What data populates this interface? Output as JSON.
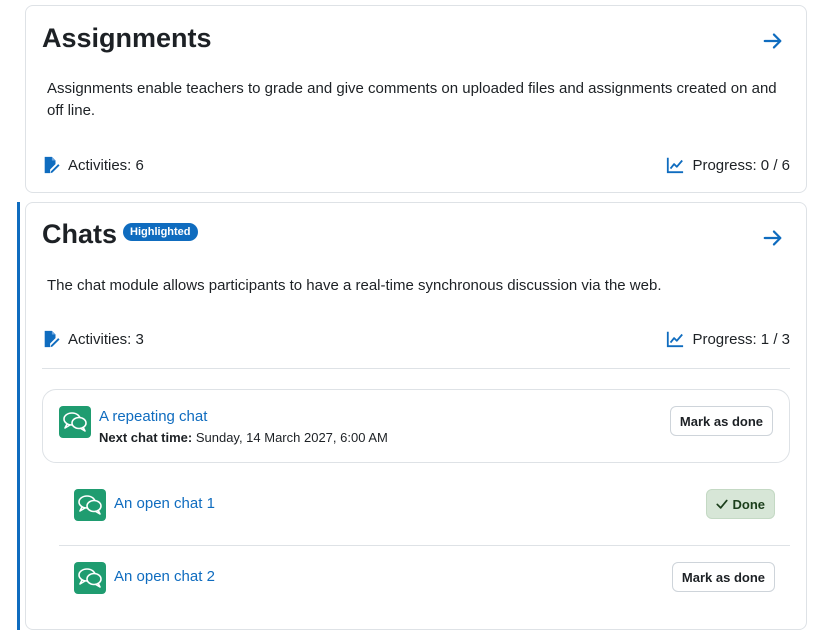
{
  "sections": [
    {
      "title": "Assignments",
      "description": "Assignments enable teachers to grade and give comments on uploaded files and assignments created on and off line.",
      "activities_label": "Activities: 6",
      "progress_label": "Progress: 0 / 6"
    },
    {
      "title": "Chats",
      "badge": "Highlighted",
      "description": "The chat module allows participants to have a real-time synchronous discussion via the web.",
      "activities_label": "Activities: 3",
      "progress_label": "Progress: 1 / 3",
      "activities": [
        {
          "name": "A repeating chat",
          "meta_label": "Next chat time:",
          "meta_value": "Sunday, 14 March 2027, 6:00 AM",
          "button": "Mark as done"
        },
        {
          "name": "An open chat 1",
          "button": "Done"
        },
        {
          "name": "An open chat 2",
          "button": "Mark as done"
        }
      ]
    }
  ],
  "colors": {
    "accent": "#0f6cbf",
    "chat_icon_bg": "#1f9c70",
    "done_bg": "#d7e6d7"
  },
  "icons": [
    "arrow-right-icon",
    "activities-icon",
    "progress-chart-icon",
    "chat-icon",
    "check-icon"
  ]
}
